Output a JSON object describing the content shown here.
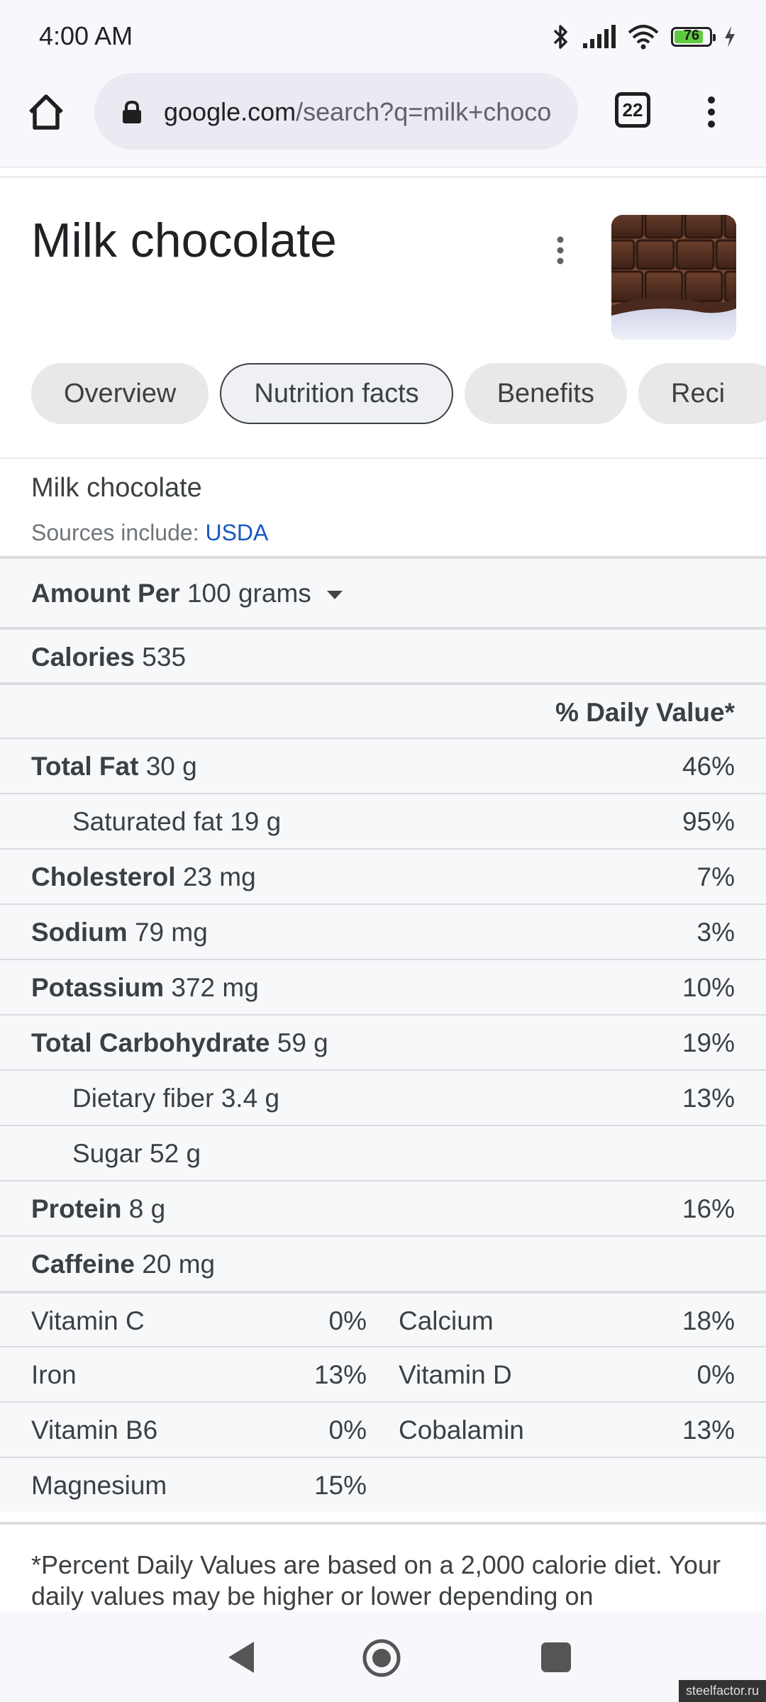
{
  "status_bar": {
    "time": "4:00 AM",
    "battery_level": "76"
  },
  "browser": {
    "url_host": "google.com",
    "url_path": "/search?q=milk+choco",
    "tab_count": "22"
  },
  "header": {
    "title": "Milk chocolate"
  },
  "chips": [
    "Overview",
    "Nutrition facts",
    "Benefits",
    "Reci"
  ],
  "nutrition": {
    "food_name": "Milk chocolate",
    "sources_prefix": "Sources include:",
    "source_link": "USDA",
    "amount_label": "Amount Per",
    "amount_value": "100 grams",
    "calories_label": "Calories",
    "calories_value": "535",
    "dv_header": "% Daily Value*",
    "rows": [
      {
        "name": "Total Fat",
        "amount": "30 g",
        "pct": "46%"
      },
      {
        "name": "Saturated fat",
        "amount": "19 g",
        "pct": "95%"
      },
      {
        "name": "Cholesterol",
        "amount": "23 mg",
        "pct": "7%"
      },
      {
        "name": "Sodium",
        "amount": "79 mg",
        "pct": "3%"
      },
      {
        "name": "Potassium",
        "amount": "372 mg",
        "pct": "10%"
      },
      {
        "name": "Total Carbohydrate",
        "amount": "59 g",
        "pct": "19%"
      },
      {
        "name": "Dietary fiber",
        "amount": "3.4 g",
        "pct": "13%"
      },
      {
        "name": "Sugar",
        "amount": "52 g",
        "pct": ""
      },
      {
        "name": "Protein",
        "amount": "8 g",
        "pct": "16%"
      },
      {
        "name": "Caffeine",
        "amount": "20 mg",
        "pct": ""
      }
    ],
    "vitamins": [
      {
        "n1": "Vitamin C",
        "v1": "0%",
        "n2": "Calcium",
        "v2": "18%"
      },
      {
        "n1": "Iron",
        "v1": "13%",
        "n2": "Vitamin D",
        "v2": "0%"
      },
      {
        "n1": "Vitamin B6",
        "v1": "0%",
        "n2": "Cobalamin",
        "v2": "13%"
      },
      {
        "n1": "Magnesium",
        "v1": "15%",
        "n2": "",
        "v2": ""
      }
    ],
    "footnote": "*Percent Daily Values are based on a 2,000 calorie diet. Your daily values may be higher or lower depending on"
  },
  "watermark": "steelfactor.ru",
  "colors": {
    "link": "#1a56c4",
    "battery": "#5ecb3e",
    "table_bg": "#f7f8fa"
  }
}
